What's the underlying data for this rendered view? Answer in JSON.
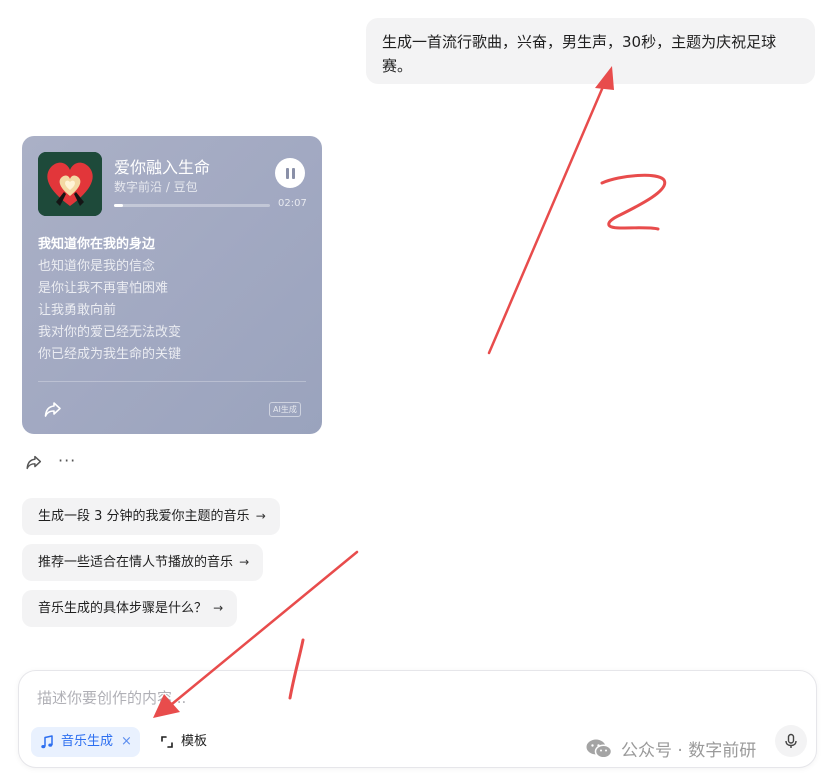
{
  "user_message": {
    "text": "生成一首流行歌曲，兴奋，男生声，30秒，主题为庆祝足球赛。"
  },
  "music_card": {
    "title": "爱你融入生命",
    "artist": "数字前沿 / 豆包",
    "duration": "02:07",
    "progress": 0.06,
    "lyrics": [
      "我知道你在我的身边",
      "也知道你是我的信念",
      "是你让我不再害怕困难",
      "让我勇敢向前",
      "我对你的爱已经无法改变",
      "你已经成为我生命的关键"
    ],
    "ai_badge": "AI生成",
    "background_color": "#a2a9c2"
  },
  "message_actions": {
    "more": "···"
  },
  "suggestions": [
    {
      "label": "生成一段 3 分钟的我爱你主题的音乐",
      "arrow": "→"
    },
    {
      "label": "推荐一些适合在情人节播放的音乐",
      "arrow": "→"
    },
    {
      "label": "音乐生成的具体步骤是什么？",
      "arrow": "→"
    }
  ],
  "input": {
    "placeholder": "描述你要创作的内容...",
    "skill_chip": {
      "label": "音乐生成",
      "close": "×"
    },
    "template_label": "模板"
  },
  "watermark": {
    "text": "公众号 · 数字前研"
  },
  "annotations": {
    "label_1": "1",
    "label_2": "2",
    "color": "#e84c4c"
  },
  "colors": {
    "accent": "#2d6ff0",
    "chip_bg": "#e9f1fe",
    "bubble_bg": "#f3f3f4"
  }
}
